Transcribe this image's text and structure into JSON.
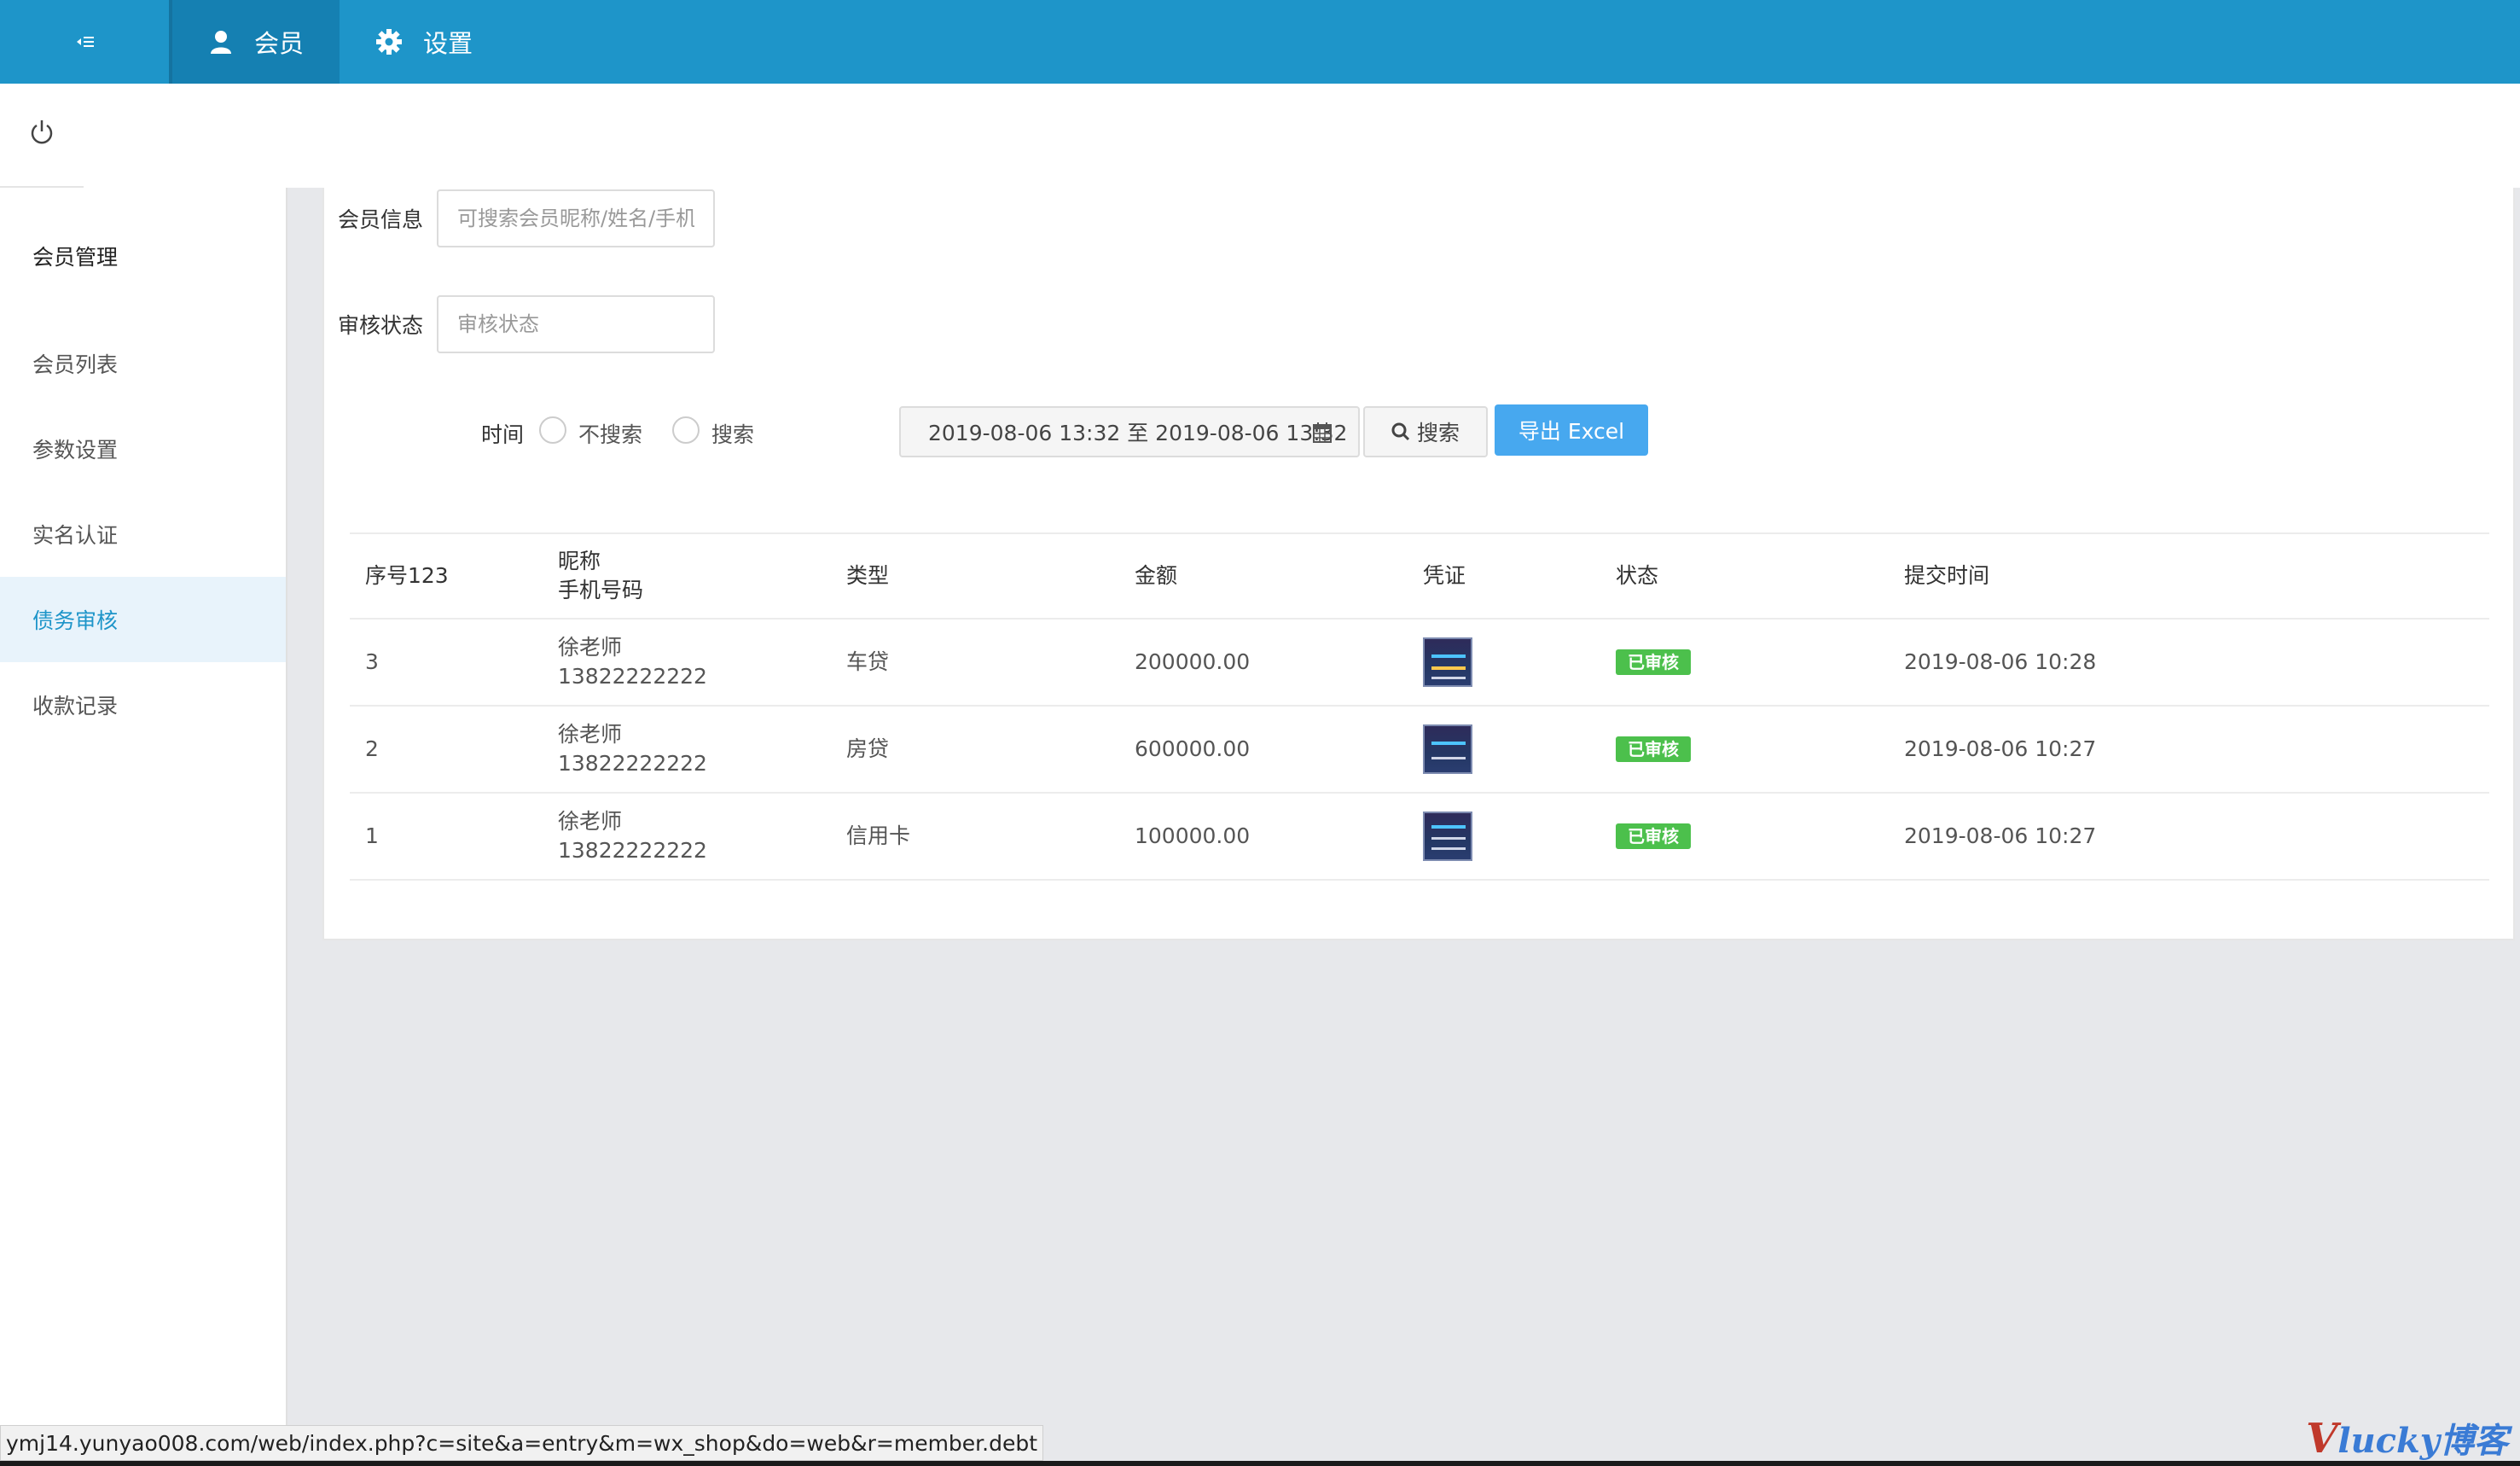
{
  "topbar": {
    "collapse_icon": "collapse-menu-icon",
    "tabs": [
      {
        "label": "会员",
        "icon": "user-icon"
      },
      {
        "label": "设置",
        "icon": "gear-icon"
      }
    ]
  },
  "sidebar": {
    "title": "会员管理",
    "items": [
      {
        "label": "会员列表"
      },
      {
        "label": "参数设置"
      },
      {
        "label": "实名认证"
      },
      {
        "label": "债务审核"
      },
      {
        "label": "收款记录"
      }
    ]
  },
  "filters": {
    "member_info_label": "会员信息",
    "member_info_placeholder": "可搜索会员昵称/姓名/手机",
    "status_label": "审核状态",
    "status_placeholder": "审核状态",
    "time_label": "时间",
    "radio_no_search": "不搜索",
    "radio_search": "搜索",
    "date_range": "2019-08-06 13:32 至 2019-08-06 13:32",
    "search_button": "搜索",
    "export_button": "导出 Excel"
  },
  "table": {
    "headers": {
      "index": "序号123",
      "nickname": "昵称",
      "phone": "手机号码",
      "type": "类型",
      "amount": "金额",
      "voucher": "凭证",
      "status": "状态",
      "submit_time": "提交时间"
    },
    "rows": [
      {
        "index": "3",
        "nickname": "徐老师",
        "phone": "13822222222",
        "type": "车贷",
        "amount": "200000.00",
        "status": "已审核",
        "submit_time": "2019-08-06 10:28"
      },
      {
        "index": "2",
        "nickname": "徐老师",
        "phone": "13822222222",
        "type": "房贷",
        "amount": "600000.00",
        "status": "已审核",
        "submit_time": "2019-08-06 10:27"
      },
      {
        "index": "1",
        "nickname": "徐老师",
        "phone": "13822222222",
        "type": "信用卡",
        "amount": "100000.00",
        "status": "已审核",
        "submit_time": "2019-08-06 10:27"
      }
    ]
  },
  "statusbar": {
    "url": "ymj14.yunyao008.com/web/index.php?c=site&a=entry&m=wx_shop&do=web&r=member.debt"
  },
  "watermark": {
    "prefix": "V",
    "text": "lucky博客"
  },
  "colors": {
    "topbar": "#1e95c9",
    "topbar_active": "#1580b2",
    "export_button": "#47a8ef",
    "badge": "#4cc04c",
    "sidebar_active_bg": "#e8f3fb"
  }
}
